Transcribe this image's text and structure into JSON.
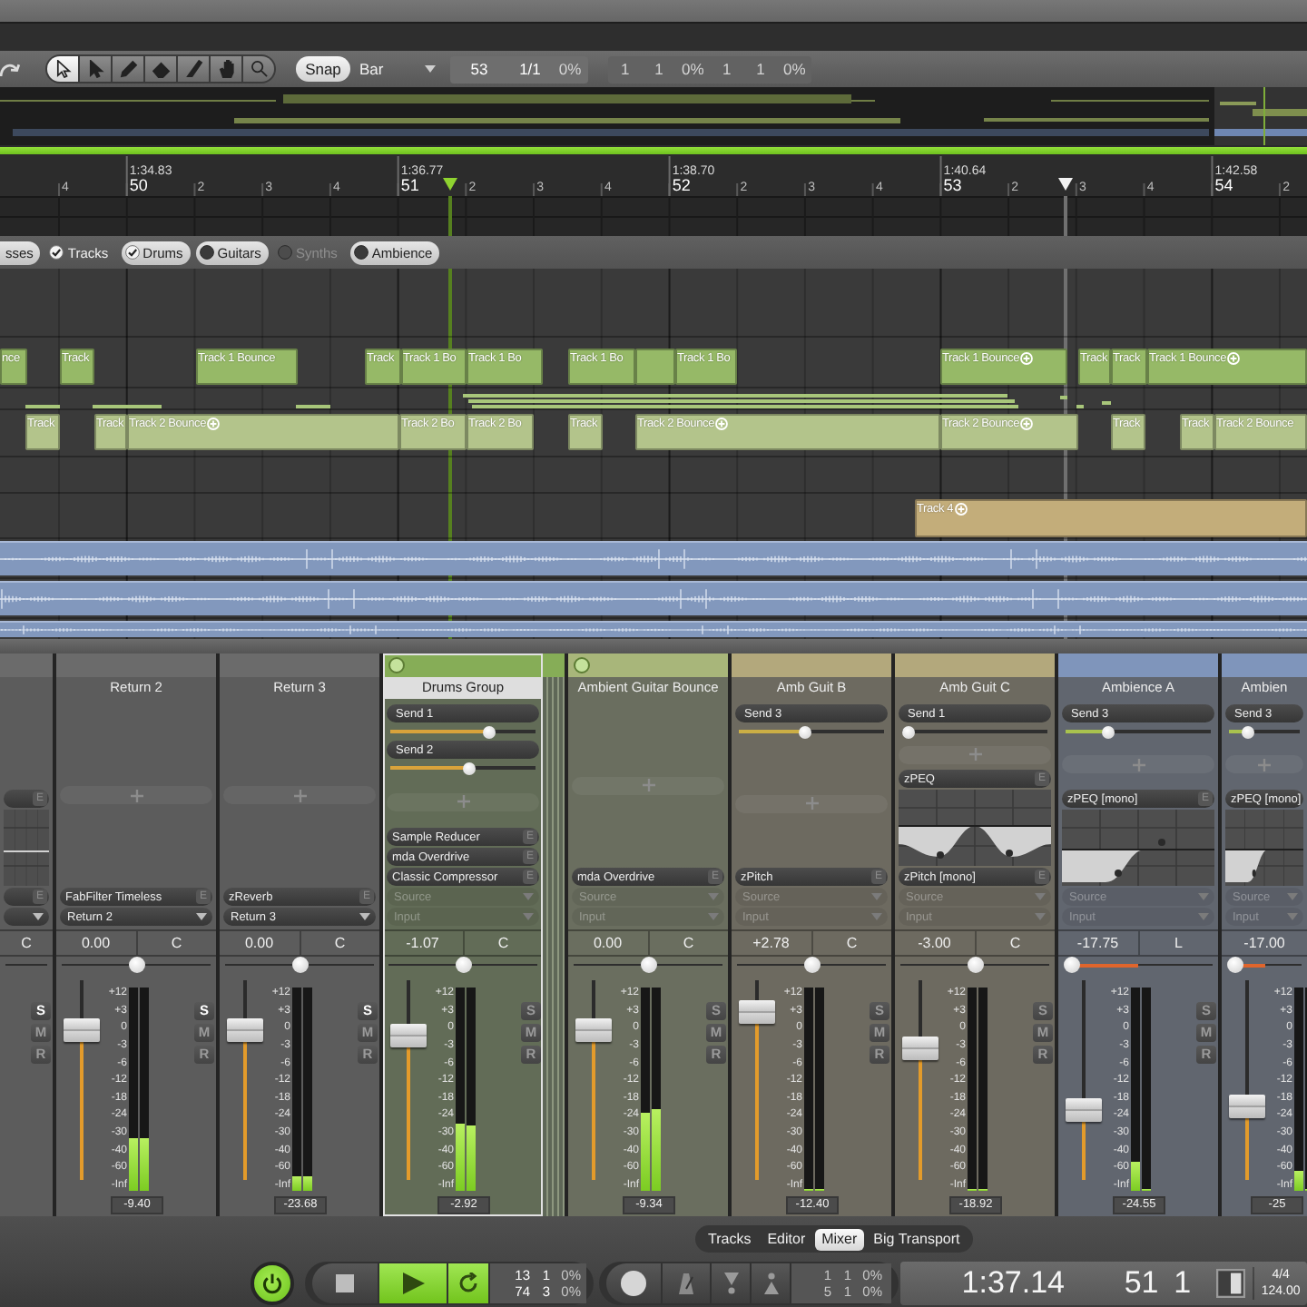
{
  "toolbar": {
    "tools": [
      {
        "kind": "select",
        "selected": true
      },
      {
        "kind": "pointer",
        "selected": false
      },
      {
        "kind": "pencil",
        "selected": false
      },
      {
        "kind": "eraser",
        "selected": false
      },
      {
        "kind": "split",
        "selected": false
      },
      {
        "kind": "hand",
        "selected": false
      },
      {
        "kind": "zoom",
        "selected": false
      }
    ],
    "snap": {
      "label": "Snap",
      "on": true
    },
    "grid": {
      "value": "Bar"
    },
    "position": [
      {
        "text": "53",
        "dim": false
      },
      {
        "text": "1/1",
        "dim": false
      },
      {
        "text": "0%",
        "dim": true
      }
    ],
    "range": [
      {
        "text": "1",
        "dim": true
      },
      {
        "text": "1",
        "dim": true
      },
      {
        "text": "0%",
        "dim": true
      },
      {
        "text": "1",
        "dim": true
      },
      {
        "text": "1",
        "dim": true
      },
      {
        "text": "0%",
        "dim": true
      }
    ]
  },
  "ruler": {
    "ticks": [
      {
        "kind": "beat",
        "label": "4"
      },
      {
        "kind": "bar",
        "time": "1:34.83",
        "label": "50"
      },
      {
        "kind": "beat",
        "label": "2"
      },
      {
        "kind": "beat",
        "label": "3"
      },
      {
        "kind": "beat",
        "label": "4"
      },
      {
        "kind": "bar",
        "time": "1:36.77",
        "label": "51"
      },
      {
        "kind": "beat",
        "label": "2"
      },
      {
        "kind": "beat",
        "label": "3"
      },
      {
        "kind": "beat",
        "label": "4"
      },
      {
        "kind": "bar",
        "time": "1:38.70",
        "label": "52"
      },
      {
        "kind": "beat",
        "label": "2"
      },
      {
        "kind": "beat",
        "label": "3"
      },
      {
        "kind": "beat",
        "label": "4"
      },
      {
        "kind": "bar",
        "time": "1:40.64",
        "label": "53"
      },
      {
        "kind": "beat",
        "label": "2"
      },
      {
        "kind": "beat",
        "label": "3"
      },
      {
        "kind": "beat",
        "label": "4"
      },
      {
        "kind": "bar",
        "time": "1:42.58",
        "label": "54"
      },
      {
        "kind": "beat",
        "label": "2"
      }
    ]
  },
  "filters": [
    {
      "label": "sses",
      "selected": true,
      "disabled": false
    },
    {
      "label": "Tracks",
      "checked": true,
      "selected": false,
      "disabled": false
    },
    {
      "label": "Drums",
      "checked": true,
      "selected": true,
      "disabled": false
    },
    {
      "label": "Guitars",
      "checked": false,
      "selected": true,
      "disabled": false
    },
    {
      "label": "Synths",
      "checked": false,
      "selected": false,
      "disabled": true
    },
    {
      "label": "Ambience",
      "checked": false,
      "selected": true,
      "disabled": false
    }
  ],
  "lanes": [
    {
      "kind": "empty"
    },
    {
      "kind": "clips",
      "color": "#96b967",
      "clips": [
        {
          "label": "nce",
          "icon": false
        },
        {
          "label": "Track",
          "icon": false
        },
        {
          "label": "Track 1 Bounce",
          "icon": false
        },
        {
          "label": "Track",
          "icon": false
        },
        {
          "label": "Track 1 Bo",
          "icon": false
        },
        {
          "label": "Track 1 Bo",
          "icon": false
        },
        {
          "label": "Track 1 Bo",
          "icon": false
        },
        {
          "icon": false
        },
        {
          "label": "Track 1 Bo",
          "icon": false
        },
        {
          "label": "Track 1 Bounce",
          "icon": true
        },
        {
          "label": "Track",
          "icon": false
        },
        {
          "label": "Track",
          "icon": false
        },
        {
          "label": "Track 1 Bounce",
          "icon": true
        }
      ]
    },
    {
      "kind": "thin",
      "color": "#a8c67a"
    },
    {
      "kind": "clips",
      "color": "#b3c48b",
      "clips": [
        {
          "label": "Track",
          "icon": false
        },
        {
          "label": "Track",
          "icon": false
        },
        {
          "label": "Track 2 Bounce",
          "icon": true
        },
        {
          "label": "Track 2 Bo",
          "icon": false
        },
        {
          "label": "Track 2 Bo",
          "icon": false
        },
        {
          "label": "Track",
          "icon": false
        },
        {
          "label": "Track 2 Bounce",
          "icon": true
        },
        {
          "label": "Track 2 Bounce",
          "icon": true
        },
        {
          "label": "Track",
          "icon": false
        },
        {
          "label": "Track",
          "icon": false
        },
        {
          "label": "Track 2 Bounce",
          "icon": false
        }
      ]
    },
    {
      "kind": "empty"
    },
    {
      "kind": "clips",
      "color": "#c3ad7a",
      "clips": [
        {
          "label": "Track 4",
          "icon": true
        }
      ]
    },
    {
      "kind": "audio",
      "color": "#8298bd"
    },
    {
      "kind": "audio",
      "color": "#8298bd"
    },
    {
      "kind": "audio",
      "color": "#8298bd"
    }
  ],
  "strips": [
    {
      "kind": "return",
      "color": "#6b6b6b",
      "selected": false,
      "folded": false,
      "add_slot": false,
      "plugins": [
        {
          "kind": "eq",
          "edit": "E"
        },
        {
          "kind": "insert",
          "edit": "E"
        }
      ],
      "dropdowns": [
        {
          "disabled": false
        }
      ],
      "pan_label": "C",
      "buttons": [
        {
          "label": "S",
          "on": true
        },
        {
          "label": "M",
          "on": false
        },
        {
          "label": "R",
          "on": false
        }
      ]
    },
    {
      "kind": "return",
      "color": "#6b6b6b",
      "name": "Return 2",
      "selected": false,
      "folded": false,
      "add_slot": true,
      "plugins": [
        {
          "kind": "insert",
          "name": "FabFilter Timeless",
          "edit": "E"
        }
      ],
      "dropdowns": [
        {
          "label": "Return 2",
          "disabled": false
        }
      ],
      "volume": "0.00",
      "pan_label": "C",
      "pan": {
        "level": 0.5
      },
      "fader": {
        "level": 0.75
      },
      "scale": [
        "+12",
        "+3",
        "0",
        "-3",
        "-6",
        "-12",
        "-18",
        "-24",
        "-30",
        "-40",
        "-60",
        "-Inf"
      ],
      "meters": [
        {
          "level": 0.26
        },
        {
          "level": 0.26
        }
      ],
      "buttons": [
        {
          "label": "S",
          "on": true
        },
        {
          "label": "M",
          "on": false
        },
        {
          "label": "R",
          "on": false
        }
      ],
      "readout": "-9.40"
    },
    {
      "kind": "return",
      "color": "#6b6b6b",
      "name": "Return 3",
      "selected": false,
      "folded": false,
      "add_slot": true,
      "plugins": [
        {
          "kind": "insert",
          "name": "zReverb",
          "edit": "E"
        }
      ],
      "dropdowns": [
        {
          "label": "Return 3",
          "disabled": false
        }
      ],
      "volume": "0.00",
      "pan_label": "C",
      "pan": {
        "level": 0.5
      },
      "fader": {
        "level": 0.75
      },
      "scale": [
        "+12",
        "+3",
        "0",
        "-3",
        "-6",
        "-12",
        "-18",
        "-24",
        "-30",
        "-40",
        "-60",
        "-Inf"
      ],
      "meters": [
        {
          "level": 0.07
        },
        {
          "level": 0.07
        }
      ],
      "buttons": [
        {
          "label": "S",
          "on": true
        },
        {
          "label": "M",
          "on": false
        },
        {
          "label": "R",
          "on": false
        }
      ],
      "readout": "-23.68"
    },
    {
      "kind": "group",
      "color": "#86ad57",
      "name": "Drums Group",
      "selected": true,
      "folded": true,
      "sends": [
        {
          "label": "Send 1",
          "level": 0.7,
          "color": "#d9a33b"
        },
        {
          "label": "Send 2",
          "level": 0.55,
          "color": "#d9a33b"
        }
      ],
      "add_slot": true,
      "plugins": [
        {
          "kind": "insert",
          "name": "Sample Reducer",
          "edit": "E"
        },
        {
          "kind": "insert",
          "name": "mda Overdrive",
          "edit": "E"
        },
        {
          "kind": "insert",
          "name": "Classic Compressor",
          "edit": "E"
        }
      ],
      "dropdowns": [
        {
          "label": "Source",
          "disabled": true
        },
        {
          "label": "Input",
          "disabled": true
        }
      ],
      "volume": "-1.07",
      "pan_label": "C",
      "pan": {
        "level": 0.5
      },
      "fader": {
        "level": 0.72
      },
      "scale": [
        "+12",
        "+3",
        "0",
        "-3",
        "-6",
        "-12",
        "-18",
        "-24",
        "-30",
        "-40",
        "-60",
        "-Inf"
      ],
      "meters": [
        {
          "level": 0.33
        },
        {
          "level": 0.32
        }
      ],
      "buttons": [
        {
          "label": "S",
          "on": false
        },
        {
          "label": "M",
          "on": false
        },
        {
          "label": "R",
          "on": false
        }
      ],
      "readout": "-2.92"
    },
    {
      "kind": "group",
      "color": "#a8b67a",
      "name": "Ambient Guitar Bounce",
      "selected": false,
      "folded": false,
      "add_slot": true,
      "plugins": [
        {
          "kind": "insert",
          "name": "mda Overdrive",
          "edit": "E"
        }
      ],
      "dropdowns": [
        {
          "label": "Source",
          "disabled": true
        },
        {
          "label": "Input",
          "disabled": true
        }
      ],
      "volume": "0.00",
      "pan_label": "C",
      "pan": {
        "level": 0.5
      },
      "fader": {
        "level": 0.75
      },
      "scale": [
        "+12",
        "+3",
        "0",
        "-3",
        "-6",
        "-12",
        "-18",
        "-24",
        "-30",
        "-40",
        "-60",
        "-Inf"
      ],
      "meters": [
        {
          "level": 0.38
        },
        {
          "level": 0.4
        }
      ],
      "buttons": [
        {
          "label": "S",
          "on": false
        },
        {
          "label": "M",
          "on": false
        },
        {
          "label": "R",
          "on": false
        }
      ],
      "readout": "-9.34"
    },
    {
      "kind": "track",
      "color": "#b3a87c",
      "name": "Amb Guit B",
      "selected": false,
      "folded": false,
      "sends": [
        {
          "label": "Send 3",
          "level": 0.45,
          "color": "#cbae45"
        }
      ],
      "add_slot": true,
      "plugins": [
        {
          "kind": "insert",
          "name": "zPitch",
          "edit": "E"
        }
      ],
      "dropdowns": [
        {
          "label": "Source",
          "disabled": true
        },
        {
          "label": "Input",
          "disabled": true
        }
      ],
      "volume": "+2.78",
      "pan_label": "C",
      "pan": {
        "level": 0.5
      },
      "fader": {
        "level": 0.84
      },
      "scale": [
        "+12",
        "+3",
        "0",
        "-3",
        "-6",
        "-12",
        "-18",
        "-24",
        "-30",
        "-40",
        "-60",
        "-Inf"
      ],
      "meters": [
        {
          "level": 0
        },
        {
          "level": 0
        }
      ],
      "buttons": [
        {
          "label": "S",
          "on": false
        },
        {
          "label": "M",
          "on": false
        },
        {
          "label": "R",
          "on": false
        }
      ],
      "readout": "-12.40"
    },
    {
      "kind": "track",
      "color": "#b3a87c",
      "name": "Amb Guit C",
      "selected": false,
      "folded": false,
      "sends": [
        {
          "label": "Send 1",
          "level": 0
        }
      ],
      "add_slot": true,
      "plugins": [
        {
          "kind": "eq",
          "name": "zPEQ",
          "edit": "E"
        },
        {
          "kind": "insert",
          "name": "zPitch [mono]",
          "edit": "E"
        }
      ],
      "dropdowns": [
        {
          "label": "Source",
          "disabled": true
        },
        {
          "label": "Input",
          "disabled": true
        }
      ],
      "volume": "-3.00",
      "pan_label": "C",
      "pan": {
        "level": 0.5
      },
      "fader": {
        "level": 0.66
      },
      "scale": [
        "+12",
        "+3",
        "0",
        "-3",
        "-6",
        "-12",
        "-18",
        "-24",
        "-30",
        "-40",
        "-60",
        "-Inf"
      ],
      "meters": [
        {
          "level": 0
        },
        {
          "level": 0
        }
      ],
      "buttons": [
        {
          "label": "S",
          "on": false
        },
        {
          "label": "M",
          "on": false
        },
        {
          "label": "R",
          "on": false
        }
      ],
      "readout": "-18.92"
    },
    {
      "kind": "track",
      "color": "#7f95bb",
      "name": "Ambience A",
      "selected": false,
      "folded": false,
      "sends": [
        {
          "label": "Send 3",
          "level": 0.27,
          "color": "#a9c24e"
        }
      ],
      "add_slot": true,
      "plugins": [
        {
          "kind": "eq",
          "name": "zPEQ [mono]",
          "edit": "E"
        }
      ],
      "dropdowns": [
        {
          "label": "Source",
          "disabled": true
        },
        {
          "label": "Input",
          "disabled": true
        }
      ],
      "volume": "-17.75",
      "pan_label": "L",
      "pan": {
        "level": 0
      },
      "fader": {
        "level": 0.35
      },
      "scale": [
        "+12",
        "+3",
        "0",
        "-3",
        "-6",
        "-12",
        "-18",
        "-24",
        "-30",
        "-40",
        "-60",
        "-Inf"
      ],
      "meters": [
        {
          "level": 0.14
        },
        {
          "level": 0
        }
      ],
      "buttons": [
        {
          "label": "S",
          "on": false
        },
        {
          "label": "M",
          "on": false
        },
        {
          "label": "R",
          "on": false
        }
      ],
      "readout": "-24.55"
    },
    {
      "kind": "track",
      "color": "#7f95bb",
      "name": "Ambien",
      "selected": false,
      "folded": false,
      "sends": [
        {
          "label": "Send 3",
          "level": 0.23,
          "color": "#a9c24e"
        }
      ],
      "add_slot": true,
      "plugins": [
        {
          "kind": "eq",
          "name": "zPEQ [mono]"
        }
      ],
      "dropdowns": [
        {
          "label": "Source",
          "disabled": true
        },
        {
          "label": "Input",
          "disabled": true
        }
      ],
      "volume": "-17.00",
      "pan": {
        "level": 0
      },
      "fader": {
        "level": 0.37
      },
      "scale": [
        "+12",
        "+3",
        "0",
        "-3",
        "-6",
        "-12",
        "-18",
        "-24",
        "-30",
        "-40",
        "-60",
        "-Inf"
      ],
      "meters": [
        {
          "level": 0.1
        },
        {
          "level": 0
        }
      ],
      "readout": "-25"
    }
  ],
  "views": [
    {
      "label": "Tracks",
      "selected": false
    },
    {
      "label": "Editor",
      "selected": false
    },
    {
      "label": "Mixer",
      "selected": true
    },
    {
      "label": "Big Transport",
      "selected": false
    }
  ],
  "transport": {
    "power": {
      "on": true
    },
    "controls": [
      {
        "kind": "stop",
        "on": false
      },
      {
        "kind": "play",
        "on": true
      },
      {
        "kind": "loop",
        "on": true
      }
    ],
    "counter": [
      {
        "cells": [
          {
            "text": "13",
            "dim": false
          },
          {
            "text": "1",
            "dim": false
          },
          {
            "text": "0%",
            "dim": true
          }
        ]
      },
      {
        "cells": [
          {
            "text": "74",
            "dim": false
          },
          {
            "text": "3",
            "dim": false
          },
          {
            "text": "0%",
            "dim": true
          }
        ]
      }
    ],
    "record_controls": [
      {
        "kind": "record",
        "on": false
      },
      {
        "kind": "metronome",
        "on": false
      },
      {
        "kind": "marker_down",
        "on": false
      },
      {
        "kind": "marker_up",
        "on": false
      }
    ],
    "counter2": [
      {
        "cells": [
          {
            "text": "1",
            "dim": true
          },
          {
            "text": "1",
            "dim": true
          },
          {
            "text": "0%",
            "dim": true
          }
        ]
      },
      {
        "cells": [
          {
            "text": "5",
            "dim": true
          },
          {
            "text": "1",
            "dim": true
          },
          {
            "text": "0%",
            "dim": true
          }
        ]
      }
    ],
    "time": "1:37.14",
    "bar": "51",
    "beat": "1",
    "signature": "4/4",
    "tempo": "124.00"
  }
}
